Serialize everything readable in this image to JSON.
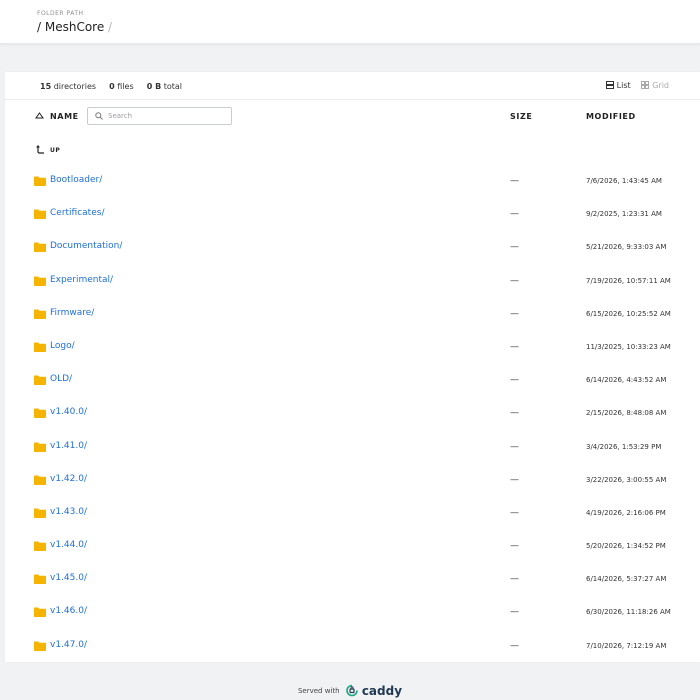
{
  "header": {
    "folder_path_label": "FOLDER PATH",
    "path_prefix": "/ ",
    "current_folder": "MeshCore",
    "path_suffix": " /"
  },
  "summary": {
    "directories_count": "15",
    "directories_label": "directories",
    "files_count": "0",
    "files_label": "files",
    "total_size": "0 B",
    "total_label": "total"
  },
  "view": {
    "list_label": "List",
    "grid_label": "Grid",
    "active": "list"
  },
  "table": {
    "name_header": "NAME",
    "size_header": "SIZE",
    "modified_header": "MODIFIED",
    "search_placeholder": "Search",
    "up_label": "UP"
  },
  "entries": [
    {
      "name": "Bootloader/",
      "size": "—",
      "modified": "7/6/2026, 1:43:45 AM"
    },
    {
      "name": "Certificates/",
      "size": "—",
      "modified": "9/2/2025, 1:23:31 AM"
    },
    {
      "name": "Documentation/",
      "size": "—",
      "modified": "5/21/2026, 9:33:03 AM"
    },
    {
      "name": "Experimental/",
      "size": "—",
      "modified": "7/19/2026, 10:57:11 AM"
    },
    {
      "name": "Firmware/",
      "size": "—",
      "modified": "6/15/2026, 10:25:52 AM"
    },
    {
      "name": "Logo/",
      "size": "—",
      "modified": "11/3/2025, 10:33:23 AM"
    },
    {
      "name": "OLD/",
      "size": "—",
      "modified": "6/14/2026, 4:43:52 AM"
    },
    {
      "name": "v1.40.0/",
      "size": "—",
      "modified": "2/15/2026, 8:48:08 AM"
    },
    {
      "name": "v1.41.0/",
      "size": "—",
      "modified": "3/4/2026, 1:53:29 PM"
    },
    {
      "name": "v1.42.0/",
      "size": "—",
      "modified": "3/22/2026, 3:00:55 AM"
    },
    {
      "name": "v1.43.0/",
      "size": "—",
      "modified": "4/19/2026, 2:16:06 PM"
    },
    {
      "name": "v1.44.0/",
      "size": "—",
      "modified": "5/20/2026, 1:34:52 PM"
    },
    {
      "name": "v1.45.0/",
      "size": "—",
      "modified": "6/14/2026, 5:37:27 AM"
    },
    {
      "name": "v1.46.0/",
      "size": "—",
      "modified": "6/30/2026, 11:18:26 AM"
    },
    {
      "name": "v1.47.0/",
      "size": "—",
      "modified": "7/10/2026, 7:12:19 AM"
    }
  ],
  "footer": {
    "served_with": "Served with",
    "brand": "caddy"
  },
  "colors": {
    "link": "#1f6fd6",
    "folder": "#f4b400",
    "caddy_green": "#1ba87e",
    "caddy_navy": "#1f3a52"
  },
  "icons": {
    "folder": "folder-icon",
    "up": "arrow-up-icon",
    "search": "search-icon",
    "sort": "sort-triangle-icon",
    "list": "list-icon",
    "grid": "grid-icon"
  }
}
